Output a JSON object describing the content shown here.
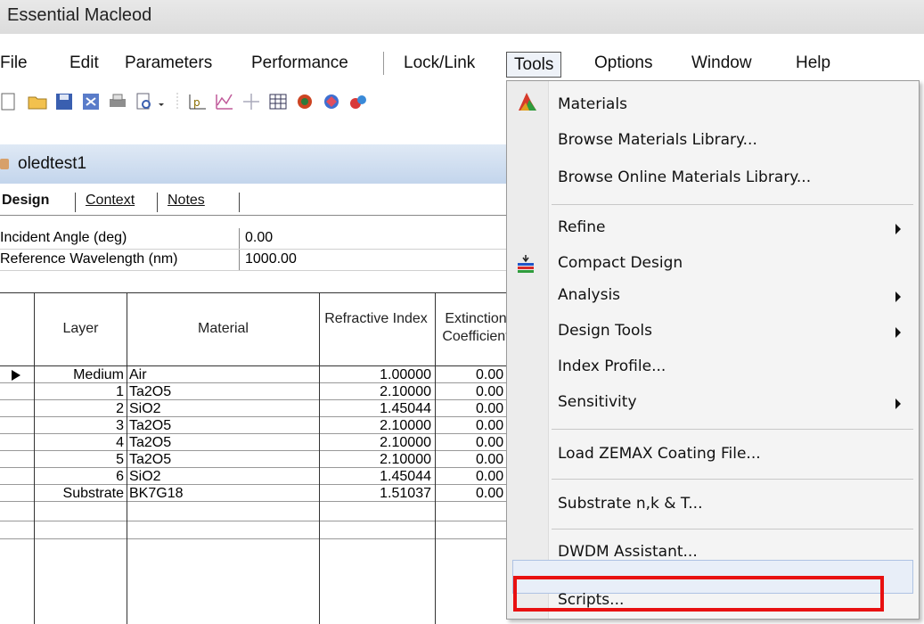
{
  "window": {
    "title": "Essential Macleod"
  },
  "menubar": {
    "items": [
      "File",
      "Edit",
      "Parameters",
      "Performance",
      "Lock/Link",
      "Tools",
      "Options",
      "Window",
      "Help"
    ]
  },
  "document": {
    "title": "oledtest1",
    "tabs": [
      "Design",
      "Context",
      "Notes"
    ],
    "properties": [
      {
        "label": "Incident Angle (deg)",
        "value": "0.00"
      },
      {
        "label": "Reference Wavelength (nm)",
        "value": "1000.00"
      }
    ],
    "table": {
      "headers": [
        "Layer",
        "Material",
        "Refractive Index",
        "Extinction Coefficient"
      ],
      "rows": [
        {
          "layer": "Medium",
          "material": "Air",
          "index": "1.00000",
          "ext": "0.00"
        },
        {
          "layer": "1",
          "material": "Ta2O5",
          "index": "2.10000",
          "ext": "0.00"
        },
        {
          "layer": "2",
          "material": "SiO2",
          "index": "1.45044",
          "ext": "0.00"
        },
        {
          "layer": "3",
          "material": "Ta2O5",
          "index": "2.10000",
          "ext": "0.00"
        },
        {
          "layer": "4",
          "material": "Ta2O5",
          "index": "2.10000",
          "ext": "0.00"
        },
        {
          "layer": "5",
          "material": "Ta2O5",
          "index": "2.10000",
          "ext": "0.00"
        },
        {
          "layer": "6",
          "material": "SiO2",
          "index": "1.45044",
          "ext": "0.00"
        },
        {
          "layer": "Substrate",
          "material": "BK7G18",
          "index": "1.51037",
          "ext": "0.00"
        }
      ]
    }
  },
  "tools_menu": {
    "items": [
      {
        "label": "Materials"
      },
      {
        "label": "Browse Materials Library..."
      },
      {
        "label": "Browse Online Materials Library..."
      },
      {
        "label": "Refine"
      },
      {
        "label": "Compact Design"
      },
      {
        "label": "Analysis"
      },
      {
        "label": "Design Tools"
      },
      {
        "label": "Index Profile..."
      },
      {
        "label": "Sensitivity"
      },
      {
        "label": "Load ZEMAX Coating File..."
      },
      {
        "label": "Substrate n,k & T..."
      },
      {
        "label": "DWDM Assistant..."
      },
      {
        "label": "Scripts..."
      }
    ]
  },
  "colors": {
    "highlight_box": "#e81010",
    "title_gradient": "#c3d5ec"
  }
}
